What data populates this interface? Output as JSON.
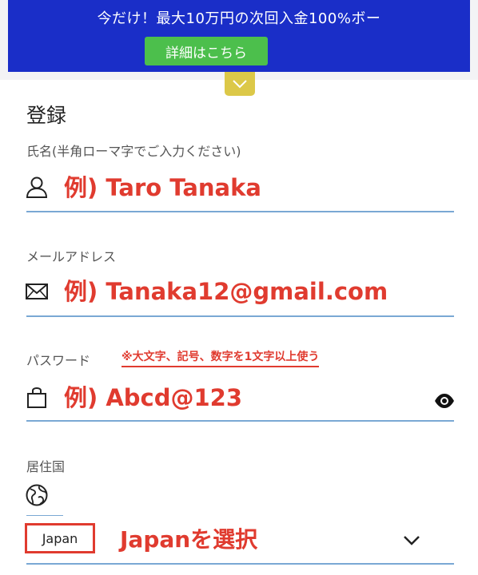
{
  "banner": {
    "text": "今だけ！最大10万円の次回入金100%ボー",
    "button_label": "詳細はこちら"
  },
  "form": {
    "title": "登録",
    "name": {
      "label": "氏名(半角ローマ字でご入力ください)",
      "placeholder": "例) Taro Tanaka",
      "icon": "user-icon"
    },
    "email": {
      "label": "メールアドレス",
      "placeholder": "例) Tanaka12@gmail.com",
      "icon": "mail-icon"
    },
    "password": {
      "label": "パスワード",
      "note": "※大文字、記号、数字を1文字以上使う",
      "placeholder": "例) Abcd@123",
      "icon": "lock-icon",
      "toggle_icon": "eye-icon"
    },
    "country": {
      "label": "居住国",
      "icon": "globe-icon",
      "selected": "Japan",
      "note": "Japanを選択"
    }
  },
  "colors": {
    "banner_bg": "#1a2ec8",
    "button_bg": "#4cbf4c",
    "toggle_bg": "#dcc848",
    "annotation_red": "#e03b2f",
    "underline": "#7aa8d4"
  }
}
